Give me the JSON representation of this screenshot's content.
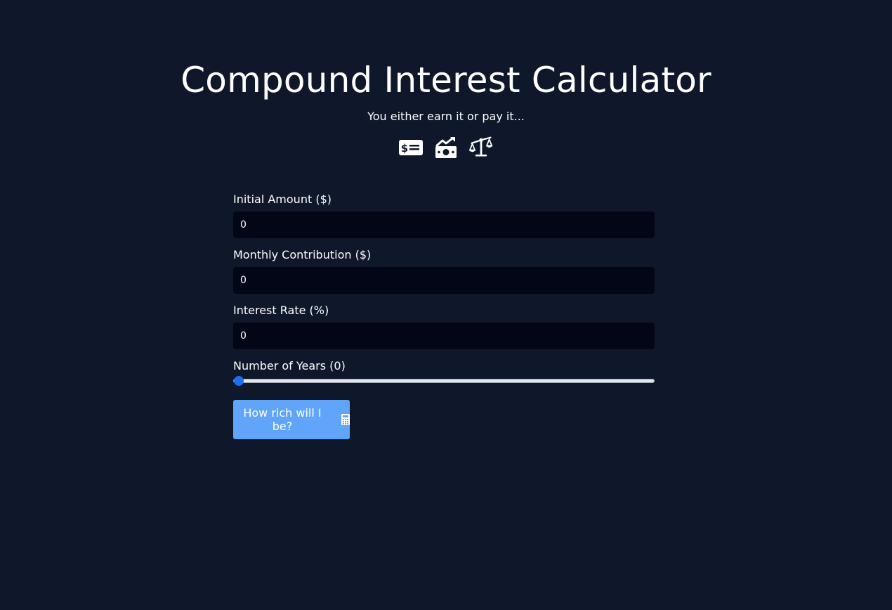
{
  "header": {
    "title": "Compound Interest Calculator",
    "subtitle": "You either earn it or pay it...",
    "icons": [
      "money-check-dollar-icon",
      "money-bill-trend-up-icon",
      "scale-balanced-icon"
    ]
  },
  "form": {
    "initial_amount": {
      "label": "Initial Amount ($)",
      "value": "0"
    },
    "monthly_contribution": {
      "label": "Monthly Contribution ($)",
      "value": "0"
    },
    "interest_rate": {
      "label": "Interest Rate (%)",
      "value": "0"
    },
    "years": {
      "label": "Number of Years (0)",
      "value": 0,
      "min": 0,
      "max": 50
    }
  },
  "button": {
    "label": "How rich will I be?",
    "icon": "calculator-icon"
  },
  "colors": {
    "background": "#0f172a",
    "input_background": "#020617",
    "button": "#60a5fa",
    "slider_thumb": "#1d6ff2"
  }
}
